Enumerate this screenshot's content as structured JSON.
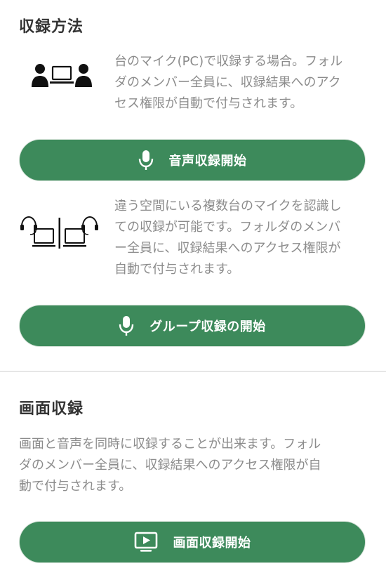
{
  "recording_method": {
    "heading": "収録方法",
    "solo": {
      "description_lines": [
        "台のマイク(PC)で収録する場合。フォル",
        "ダのメンバー全員に、収録結果へのアク",
        "セス権限が自動で付与されます。"
      ],
      "button_label": "音声収録開始"
    },
    "group": {
      "description_lines": [
        "違う空間にいる複数台のマイクを認識し",
        "ての収録が可能です。フォルダのメンバ",
        "ー全員に、収録結果へのアクセス権限が",
        "自動で付与されます。"
      ],
      "button_label": "グループ収録の開始"
    }
  },
  "screen_recording": {
    "heading": "画面収録",
    "description_lines": [
      "画面と音声を同時に収録することが出来ます。フォル",
      "ダのメンバー全員に、収録結果へのアクセス権限が自",
      "動で付与されます。"
    ],
    "button_label": "画面収録開始"
  },
  "icons": {
    "solo": "two-people-laptop-icon",
    "group": "headset-laptops-icon",
    "mic": "microphone-icon",
    "screen": "screen-play-icon"
  },
  "colors": {
    "button": "#3d8a5b",
    "heading": "#333333",
    "description": "#8c8c8c",
    "divider": "#e6e6e6"
  }
}
